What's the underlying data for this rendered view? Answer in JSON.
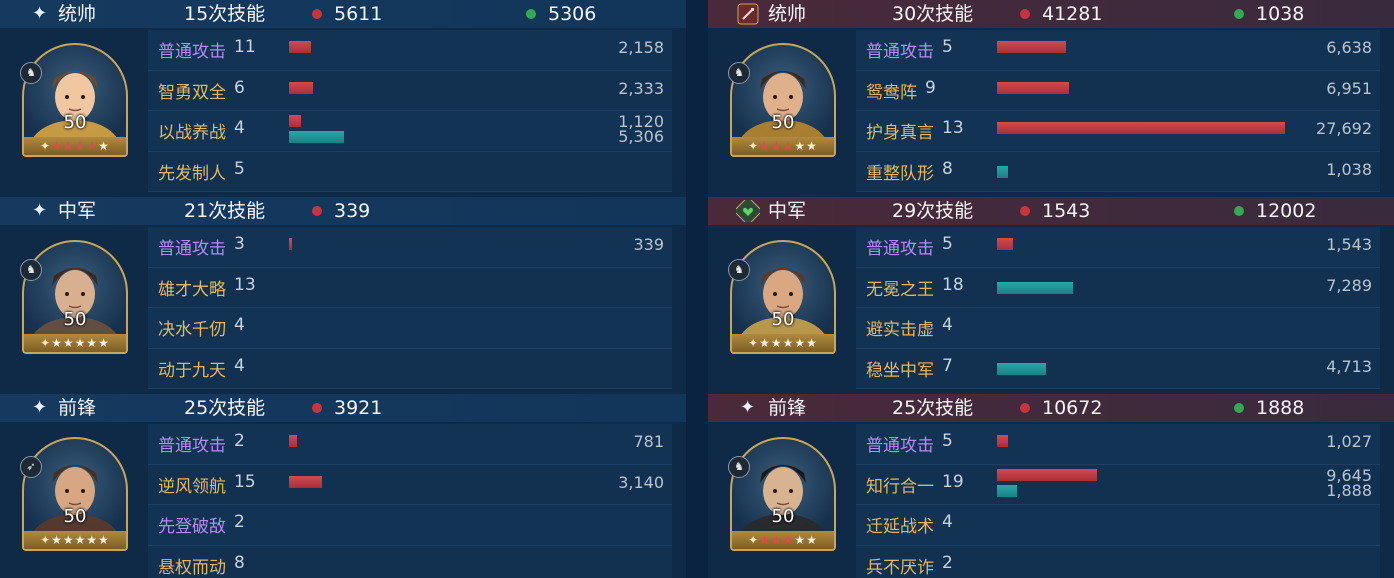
{
  "left": {
    "sections": [
      {
        "role": "统帅",
        "casts": "15次技能",
        "damage": "5611",
        "heal": "5306",
        "level": "50",
        "troop_icon": "cavalry-icon",
        "stars_red": 4,
        "stars_total": 5,
        "skills": [
          {
            "name": "普通攻击",
            "count": "11",
            "color": "purple",
            "damage": "2,158",
            "heal": "",
            "dmg_ratio": 0.078,
            "heal_ratio": 0
          },
          {
            "name": "智勇双全",
            "count": "6",
            "color": "gold",
            "damage": "2,333",
            "heal": "",
            "dmg_ratio": 0.084,
            "heal_ratio": 0
          },
          {
            "name": "以战养战",
            "count": "4",
            "color": "gold",
            "damage": "1,120",
            "heal": "5,306",
            "dmg_ratio": 0.04,
            "heal_ratio": 0.19
          },
          {
            "name": "先发制人",
            "count": "5",
            "color": "gold",
            "damage": "",
            "heal": "",
            "dmg_ratio": 0,
            "heal_ratio": 0
          }
        ]
      },
      {
        "role": "中军",
        "casts": "21次技能",
        "damage": "339",
        "heal": "",
        "level": "50",
        "troop_icon": "cavalry-icon",
        "stars_red": 0,
        "stars_total": 5,
        "skills": [
          {
            "name": "普通攻击",
            "count": "3",
            "color": "purple",
            "damage": "339",
            "heal": "",
            "dmg_ratio": 0.012,
            "heal_ratio": 0
          },
          {
            "name": "雄才大略",
            "count": "13",
            "color": "gold",
            "damage": "",
            "heal": "",
            "dmg_ratio": 0,
            "heal_ratio": 0
          },
          {
            "name": "决水千仞",
            "count": "4",
            "color": "gold",
            "damage": "",
            "heal": "",
            "dmg_ratio": 0,
            "heal_ratio": 0
          },
          {
            "name": "动于九天",
            "count": "4",
            "color": "gold",
            "damage": "",
            "heal": "",
            "dmg_ratio": 0,
            "heal_ratio": 0
          }
        ]
      },
      {
        "role": "前锋",
        "casts": "25次技能",
        "damage": "3921",
        "heal": "",
        "level": "50",
        "troop_icon": "archer-icon",
        "stars_red": 0,
        "stars_total": 5,
        "skills": [
          {
            "name": "普通攻击",
            "count": "2",
            "color": "purple",
            "damage": "781",
            "heal": "",
            "dmg_ratio": 0.028,
            "heal_ratio": 0
          },
          {
            "name": "逆风领航",
            "count": "15",
            "color": "gold",
            "damage": "3,140",
            "heal": "",
            "dmg_ratio": 0.113,
            "heal_ratio": 0
          },
          {
            "name": "先登破敌",
            "count": "2",
            "color": "purple",
            "damage": "",
            "heal": "",
            "dmg_ratio": 0,
            "heal_ratio": 0
          },
          {
            "name": "悬权而动",
            "count": "8",
            "color": "gold",
            "damage": "",
            "heal": "",
            "dmg_ratio": 0,
            "heal_ratio": 0
          }
        ]
      }
    ]
  },
  "right": {
    "sections": [
      {
        "role": "统帅",
        "casts": "30次技能",
        "damage": "41281",
        "heal": "1038",
        "level": "50",
        "troop_icon": "cavalry-icon",
        "stars_red": 3,
        "stars_total": 5,
        "badge": "sword-badge",
        "skills": [
          {
            "name": "普通攻击",
            "count": "5",
            "color": "purple",
            "damage": "6,638",
            "heal": "",
            "dmg_ratio": 0.24,
            "heal_ratio": 0
          },
          {
            "name": "鸳鸯阵",
            "count": "9",
            "color": "gold",
            "damage": "6,951",
            "heal": "",
            "dmg_ratio": 0.251,
            "heal_ratio": 0
          },
          {
            "name": "护身真言",
            "count": "13",
            "color": "gold",
            "damage": "27,692",
            "heal": "",
            "dmg_ratio": 1.0,
            "heal_ratio": 0
          },
          {
            "name": "重整队形",
            "count": "8",
            "color": "gold",
            "damage": "",
            "heal": "1,038",
            "dmg_ratio": 0,
            "heal_ratio": 0.037
          }
        ]
      },
      {
        "role": "中军",
        "casts": "29次技能",
        "damage": "1543",
        "heal": "12002",
        "level": "50",
        "troop_icon": "cavalry-icon",
        "stars_red": 0,
        "stars_total": 5,
        "badge": "heart-badge",
        "skills": [
          {
            "name": "普通攻击",
            "count": "5",
            "color": "purple",
            "damage": "1,543",
            "heal": "",
            "dmg_ratio": 0.056,
            "heal_ratio": 0
          },
          {
            "name": "无冕之王",
            "count": "18",
            "color": "gold",
            "damage": "",
            "heal": "7,289",
            "dmg_ratio": 0,
            "heal_ratio": 0.263
          },
          {
            "name": "避实击虚",
            "count": "4",
            "color": "gold",
            "damage": "",
            "heal": "",
            "dmg_ratio": 0,
            "heal_ratio": 0
          },
          {
            "name": "稳坐中军",
            "count": "7",
            "color": "gold",
            "damage": "",
            "heal": "4,713",
            "dmg_ratio": 0,
            "heal_ratio": 0.17
          }
        ]
      },
      {
        "role": "前锋",
        "casts": "25次技能",
        "damage": "10672",
        "heal": "1888",
        "level": "50",
        "troop_icon": "cavalry-icon",
        "stars_red": 3,
        "stars_total": 5,
        "badge": "",
        "skills": [
          {
            "name": "普通攻击",
            "count": "5",
            "color": "purple",
            "damage": "1,027",
            "heal": "",
            "dmg_ratio": 0.037,
            "heal_ratio": 0
          },
          {
            "name": "知行合一",
            "count": "19",
            "color": "gold",
            "damage": "9,645",
            "heal": "1,888",
            "dmg_ratio": 0.348,
            "heal_ratio": 0.068
          },
          {
            "name": "迁延战术",
            "count": "4",
            "color": "gold",
            "damage": "",
            "heal": "",
            "dmg_ratio": 0,
            "heal_ratio": 0
          },
          {
            "name": "兵不厌诈",
            "count": "2",
            "color": "gold",
            "damage": "",
            "heal": "",
            "dmg_ratio": 0,
            "heal_ratio": 0
          }
        ]
      }
    ]
  },
  "colors": {
    "damage": "#c7343e",
    "heal": "#34a853",
    "purple_skill": "#b48cf0",
    "gold_skill": "#e6b85c"
  }
}
